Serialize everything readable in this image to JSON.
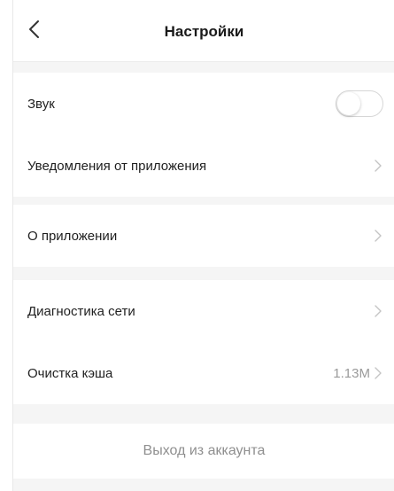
{
  "header": {
    "title": "Настройки",
    "back_icon": "chevron-left-icon"
  },
  "groups": [
    {
      "items": [
        {
          "label": "Звук",
          "control": "toggle",
          "toggle_on": false
        },
        {
          "label": "Уведомления от приложения",
          "control": "chevron"
        }
      ]
    },
    {
      "items": [
        {
          "label": "О приложении",
          "control": "chevron"
        }
      ]
    },
    {
      "items": [
        {
          "label": "Диагностика сети",
          "control": "chevron"
        },
        {
          "label": "Очистка кэша",
          "value": "1.13M",
          "control": "chevron"
        }
      ]
    }
  ],
  "logout": {
    "label": "Выход из аккаунта"
  },
  "colors": {
    "background": "#f5f5f5",
    "surface": "#ffffff",
    "text": "#1f1f1f",
    "muted": "#9a9a9a"
  }
}
